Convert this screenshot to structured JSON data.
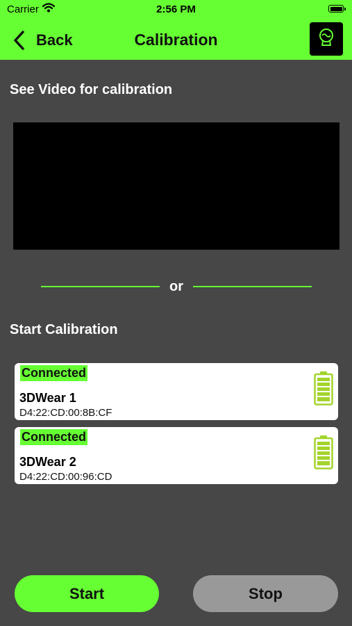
{
  "status_bar": {
    "carrier": "Carrier",
    "time": "2:56 PM"
  },
  "nav": {
    "back_label": "Back",
    "title": "Calibration"
  },
  "video_section": {
    "title": "See Video for calibration"
  },
  "divider": {
    "text": "or"
  },
  "calibration_section": {
    "title": "Start Calibration"
  },
  "devices": [
    {
      "status": "Connected",
      "name": "3DWear 1",
      "mac": "D4:22:CD:00:8B:CF"
    },
    {
      "status": "Connected",
      "name": "3DWear 2",
      "mac": "D4:22:CD:00:96:CD"
    }
  ],
  "actions": {
    "start_label": "Start",
    "stop_label": "Stop"
  },
  "colors": {
    "accent": "#66ff33",
    "background": "#474747",
    "card": "#ffffff",
    "stop_button": "#999999",
    "battery": "#a3d42b"
  },
  "icons": {
    "back": "chevron-left-icon",
    "logo": "app-logo-icon",
    "battery": "battery-full-icon",
    "wifi": "wifi-icon"
  }
}
